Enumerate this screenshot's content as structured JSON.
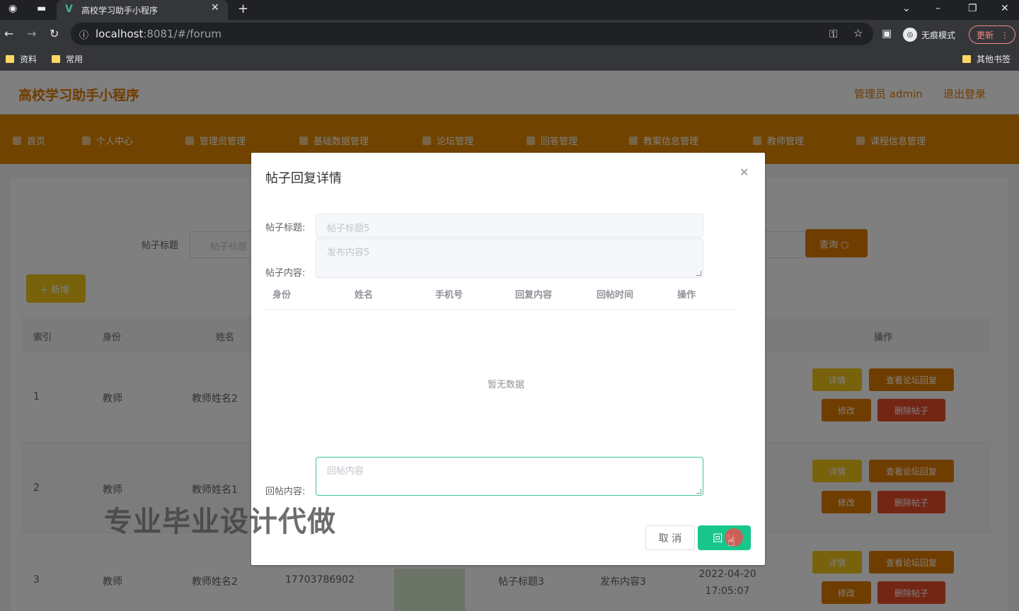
{
  "browser": {
    "tab_title": "高校学习助手小程序",
    "url_host": "localhost",
    "url_rest": ":8081/#/forum",
    "incognito_label": "无痕模式",
    "update_label": "更新",
    "bookmarks": [
      "资料",
      "常用"
    ],
    "other_bookmarks": "其他书签"
  },
  "app": {
    "title": "高校学习助手小程序",
    "user": "管理员 admin",
    "logout": "退出登录",
    "menu": [
      "首页",
      "个人中心",
      "管理员管理",
      "基础数据管理",
      "论坛管理",
      "回答管理",
      "教案信息管理",
      "教师管理",
      "课程信息管理"
    ]
  },
  "search": {
    "label": "帖子标题",
    "placeholder": "帖子标题",
    "query_label": "查询",
    "add_label": "+ 新增"
  },
  "table": {
    "headers": [
      "索引",
      "身份",
      "姓名",
      "操作"
    ],
    "rows": [
      {
        "index": "1",
        "role": "教师",
        "name": "教师姓名2"
      },
      {
        "index": "2",
        "role": "教师",
        "name": "教师姓名1"
      },
      {
        "index": "3",
        "role": "教师",
        "name": "教师姓名2",
        "phone": "17703786902",
        "title": "帖子标题3",
        "content": "发布内容3",
        "time": "2022-04-20 17:05:07"
      }
    ],
    "actions": {
      "detail": "详情",
      "view_reply": "查看论坛回复",
      "edit": "修改",
      "delete": "删除帖子"
    }
  },
  "dialog": {
    "title": "帖子回复详情",
    "post_title_label": "帖子标题:",
    "post_title_value": "帖子标题5",
    "post_content_label": "帖子内容:",
    "post_content_value": "发布内容5",
    "reply_headers": [
      "身份",
      "姓名",
      "手机号",
      "回复内容",
      "回帖时间",
      "操作"
    ],
    "empty_text": "暂无数据",
    "reply_label": "回帖内容:",
    "reply_placeholder": "回帖内容",
    "cancel_label": "取 消",
    "confirm_label": "回 帖"
  },
  "watermark": "专业毕业设计代做",
  "colors": {
    "accent": "#e07b00",
    "confirm": "#18c68b",
    "focus": "#3cc5a0"
  }
}
